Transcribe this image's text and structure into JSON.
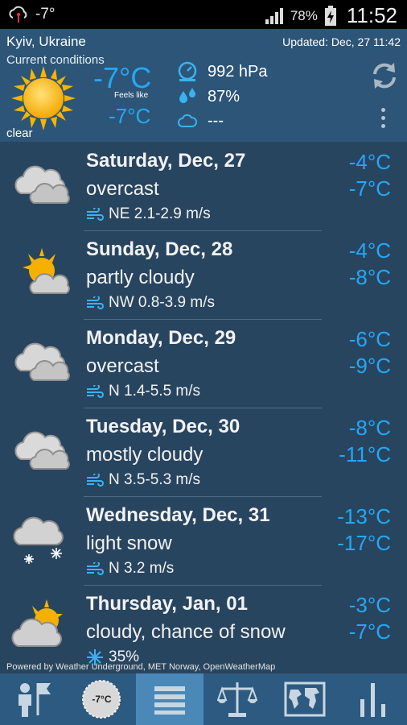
{
  "status_bar": {
    "temp": "-7°",
    "battery": "78%",
    "time": "11:52"
  },
  "current": {
    "location": "Kyiv, Ukraine",
    "updated": "Updated: Dec, 27 11:42",
    "label": "Current conditions",
    "condition": "clear",
    "temperature": "-7°C",
    "feels_like_label": "Feels like",
    "feels_like": "-7°C",
    "pressure": "992 hPa",
    "humidity": "87%",
    "cloud": "---"
  },
  "forecast": [
    {
      "day": "Saturday, Dec, 27",
      "condition": "overcast",
      "wind": "NE 2.1-2.9 m/s",
      "high": "-4°C",
      "low": "-7°C",
      "icon": "overcast-icon"
    },
    {
      "day": "Sunday, Dec, 28",
      "condition": "partly cloudy",
      "wind": "NW 0.8-3.9 m/s",
      "high": "-4°C",
      "low": "-8°C",
      "icon": "partly-cloudy-icon"
    },
    {
      "day": "Monday, Dec, 29",
      "condition": "overcast",
      "wind": "N 1.4-5.5 m/s",
      "high": "-6°C",
      "low": "-9°C",
      "icon": "overcast-icon"
    },
    {
      "day": "Tuesday, Dec, 30",
      "condition": "mostly cloudy",
      "wind": "N 3.5-5.3 m/s",
      "high": "-8°C",
      "low": "-11°C",
      "icon": "mostly-cloudy-icon"
    },
    {
      "day": "Wednesday, Dec, 31",
      "condition": "light snow",
      "wind": "N 3.2 m/s",
      "high": "-13°C",
      "low": "-17°C",
      "icon": "light-snow-icon"
    },
    {
      "day": "Thursday, Jan, 01",
      "condition": "cloudy, chance of snow",
      "wind": "35%",
      "high": "-3°C",
      "low": "-7°C",
      "icon": "cloudy-chance-snow-icon"
    }
  ],
  "powered_by": "Powered by Weather Underground, MET Norway, OpenWeatherMap",
  "tabs": {
    "badge_temp": "-7°C"
  },
  "colors": {
    "accent": "#26a7f5",
    "header_bg": "#2c5578",
    "list_bg": "#284560",
    "tab_active": "#4a88b8"
  }
}
